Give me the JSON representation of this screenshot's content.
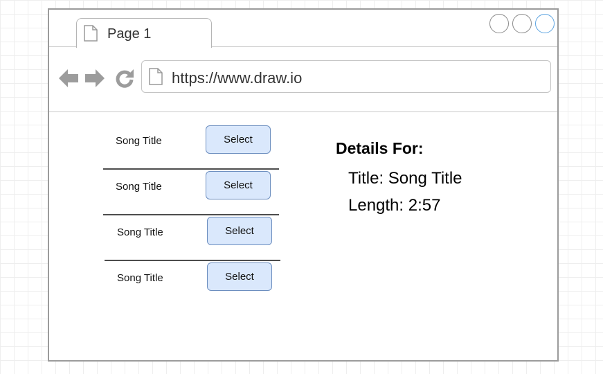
{
  "browser": {
    "tab": {
      "label": "Page 1"
    },
    "address_bar": {
      "url": "https://www.draw.io"
    }
  },
  "songs": [
    {
      "title": "Song Title",
      "button_label": "Select"
    },
    {
      "title": "Song Title",
      "button_label": "Select"
    },
    {
      "title": "Song Title",
      "button_label": "Select"
    },
    {
      "title": "Song Title",
      "button_label": "Select"
    }
  ],
  "details": {
    "heading": "Details For:",
    "title_line": "Title: Song Title",
    "length_line": "Length: 2:57"
  },
  "colors": {
    "button_fill": "#dae8fc",
    "button_border": "#6c8ebf",
    "window_border": "#9b9b9b",
    "active_window_button": "#5ba3e0"
  },
  "icons": [
    "page-icon",
    "back-arrow-icon",
    "forward-arrow-icon",
    "reload-icon",
    "window-button"
  ]
}
